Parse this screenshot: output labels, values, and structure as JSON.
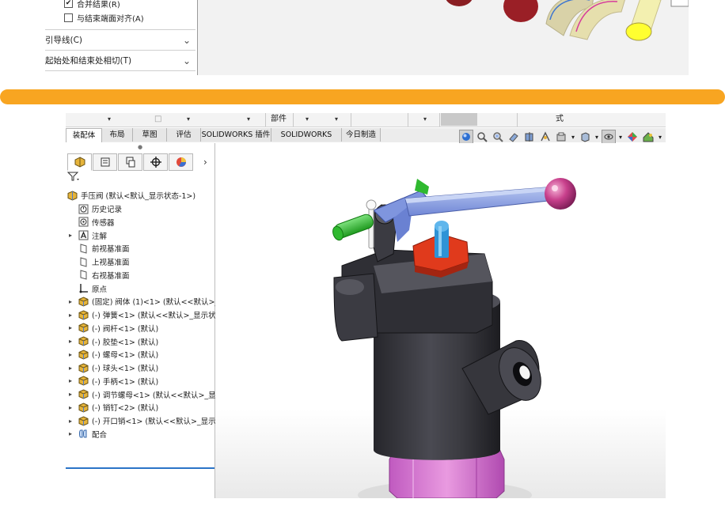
{
  "top_panel": {
    "checkboxes": [
      {
        "label": "合并结果(R)",
        "checked": true,
        "mark": "✔"
      },
      {
        "label": "与结束端面对齐(A)",
        "checked": false,
        "mark": ""
      }
    ],
    "groups": [
      "引导线(C)",
      "起始处和结束处相切(T)"
    ]
  },
  "command_strip": {
    "items": [
      "□",
      "部件",
      "式"
    ]
  },
  "tabs": [
    "装配体",
    "布局",
    "草图",
    "评估",
    "SOLIDWORKS 插件",
    "SOLIDWORKS MBD",
    "今日制造"
  ],
  "active_tab": "装配体",
  "feature_tree": {
    "root": "手压阀 (默认<默认_显示状态-1>)",
    "items": [
      {
        "label": "历史记录",
        "icon": "history-icon",
        "expandable": false
      },
      {
        "label": "传感器",
        "icon": "sensor-icon",
        "expandable": false
      },
      {
        "label": "注解",
        "icon": "annotation-icon",
        "expandable": true
      },
      {
        "label": "前视基准面",
        "icon": "plane-icon",
        "expandable": false
      },
      {
        "label": "上视基准面",
        "icon": "plane-icon",
        "expandable": false
      },
      {
        "label": "右视基准面",
        "icon": "plane-icon",
        "expandable": false
      },
      {
        "label": "原点",
        "icon": "origin-icon",
        "expandable": false
      },
      {
        "label": "(固定) 阀体 (1)<1> (默认<<默认>_显示",
        "icon": "part-icon",
        "expandable": true
      },
      {
        "label": "(-) 弹簧<1> (默认<<默认>_显示状态",
        "icon": "part-icon",
        "expandable": true
      },
      {
        "label": "(-) 阀杆<1> (默认)",
        "icon": "part-icon",
        "expandable": true
      },
      {
        "label": "(-) 胶垫<1> (默认)",
        "icon": "part-icon",
        "expandable": true
      },
      {
        "label": "(-) 螺母<1> (默认)",
        "icon": "part-icon",
        "expandable": true
      },
      {
        "label": "(-) 球头<1> (默认)",
        "icon": "part-icon",
        "expandable": true
      },
      {
        "label": "(-) 手柄<1> (默认)",
        "icon": "part-icon",
        "expandable": true
      },
      {
        "label": "(-) 调节螺母<1> (默认<<默认>_显示",
        "icon": "part-icon",
        "expandable": true
      },
      {
        "label": "(-) 销钉<2> (默认)",
        "icon": "part-icon",
        "expandable": true
      },
      {
        "label": "(-) 开口销<1> (默认<<默认>_显示状",
        "icon": "part-icon",
        "expandable": true
      },
      {
        "label": "配合",
        "icon": "mates-icon",
        "expandable": true
      }
    ]
  },
  "manager_tabs": [
    "feature-manager-icon",
    "property-manager-icon",
    "configuration-manager-icon",
    "dimxpert-icon",
    "display-manager-icon"
  ],
  "hud_icons": [
    "view-orientation-icon",
    "zoom-to-fit-icon",
    "zoom-area-icon",
    "previous-view-icon",
    "section-view-icon",
    "dynamic-annotation-icon",
    "view-setting-icon",
    "display-style-icon",
    "hide-show-icon",
    "edit-appearance-icon",
    "apply-scene-icon"
  ],
  "colors": {
    "accent_divider": "#f8a521",
    "selection_line": "#2b74c7",
    "body_dark": "#3a3a40",
    "handle_blue": "#8fa4e6",
    "ball_pink": "#c8408c",
    "nut_red": "#e03a1c",
    "base_magenta": "#d77ad0",
    "pin_green": "#2fb92f"
  }
}
